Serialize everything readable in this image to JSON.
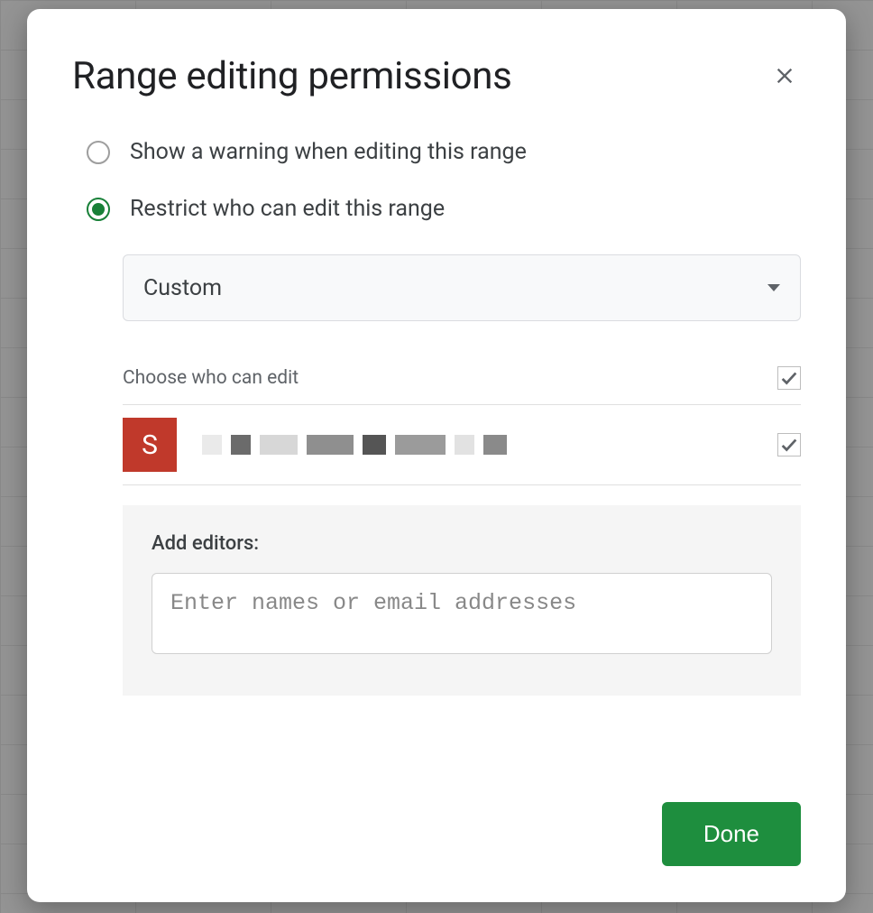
{
  "dialog": {
    "title": "Range editing permissions",
    "options": {
      "warning": "Show a warning when editing this range",
      "restrict": "Restrict who can edit this range",
      "selected": "restrict"
    },
    "restrict_mode": {
      "selected_label": "Custom"
    },
    "editors_section": {
      "header_label": "Choose who can edit",
      "all_checked": true,
      "rows": [
        {
          "avatar_letter": "S",
          "avatar_color": "#c0392b",
          "checked": true
        }
      ]
    },
    "add_editors": {
      "label": "Add editors:",
      "placeholder": "Enter names or email addresses",
      "value": ""
    },
    "done_label": "Done"
  }
}
